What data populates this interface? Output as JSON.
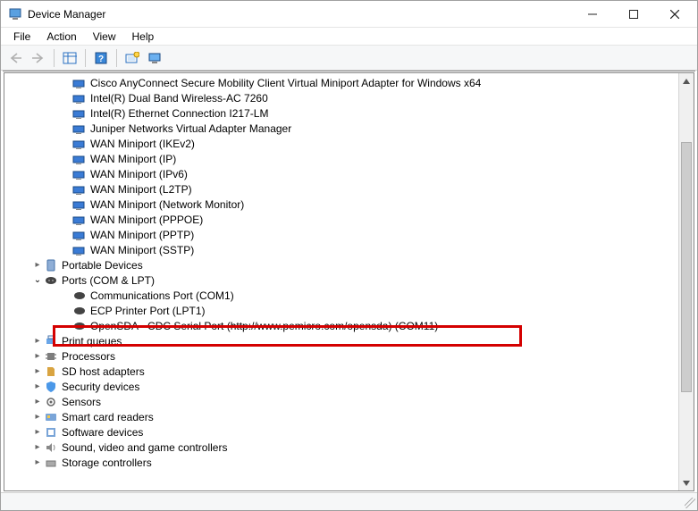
{
  "window": {
    "title": "Device Manager"
  },
  "menu": {
    "file": "File",
    "action": "Action",
    "view": "View",
    "help": "Help"
  },
  "tree": {
    "network_adapters": [
      "Cisco AnyConnect Secure Mobility Client Virtual Miniport Adapter for Windows x64",
      "Intel(R) Dual Band Wireless-AC 7260",
      "Intel(R) Ethernet Connection I217-LM",
      "Juniper Networks Virtual Adapter Manager",
      "WAN Miniport (IKEv2)",
      "WAN Miniport (IP)",
      "WAN Miniport (IPv6)",
      "WAN Miniport (L2TP)",
      "WAN Miniport (Network Monitor)",
      "WAN Miniport (PPPOE)",
      "WAN Miniport (PPTP)",
      "WAN Miniport (SSTP)"
    ],
    "portable_devices": "Portable Devices",
    "ports": {
      "label": "Ports (COM & LPT)",
      "items": [
        "Communications Port (COM1)",
        "ECP Printer Port (LPT1)",
        "OpenSDA - CDC Serial Port (http://www.pemicro.com/opensda) (COM11)"
      ]
    },
    "print_queues": "Print queues",
    "processors": "Processors",
    "sd_host": "SD host adapters",
    "security": "Security devices",
    "sensors": "Sensors",
    "smartcard": "Smart card readers",
    "software": "Software devices",
    "sound": "Sound, video and game controllers",
    "storage": "Storage controllers"
  }
}
